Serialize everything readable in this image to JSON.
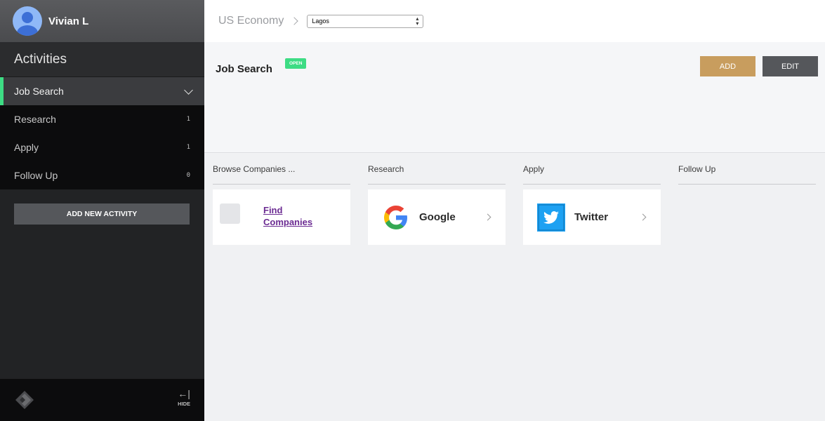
{
  "user": {
    "name": "Vivian L"
  },
  "sidebar": {
    "title": "Activities",
    "active_item": {
      "label": "Job Search"
    },
    "items": [
      {
        "label": "Research",
        "count": "1"
      },
      {
        "label": "Apply",
        "count": "1"
      },
      {
        "label": "Follow Up",
        "count": "0"
      }
    ],
    "add_button": "ADD NEW ACTIVITY",
    "hide_label": "HIDE",
    "hide_arrow": "←|"
  },
  "topbar": {
    "breadcrumb": "US Economy",
    "city_select": {
      "value": "Lagos",
      "arrows": "▲▼"
    }
  },
  "header": {
    "title": "Job Search",
    "status_badge": "OPEN",
    "add_label": "ADD",
    "edit_label": "EDIT"
  },
  "columns": [
    {
      "header": "Browse Companies ...",
      "card": {
        "link_line1": "Find",
        "link_line2": "Companies"
      }
    },
    {
      "header": "Research",
      "card": {
        "name": "Google",
        "icon": "google-icon"
      }
    },
    {
      "header": "Apply",
      "card": {
        "name": "Twitter",
        "icon": "twitter-icon"
      }
    },
    {
      "header": "Follow Up"
    }
  ],
  "colors": {
    "accent_green": "#3ddc84",
    "add_button": "#c89d5e",
    "edit_button": "#55575b",
    "sidebar_bg": "#222325",
    "link_purple": "#6b2b92",
    "twitter_blue": "#1da1f2"
  }
}
